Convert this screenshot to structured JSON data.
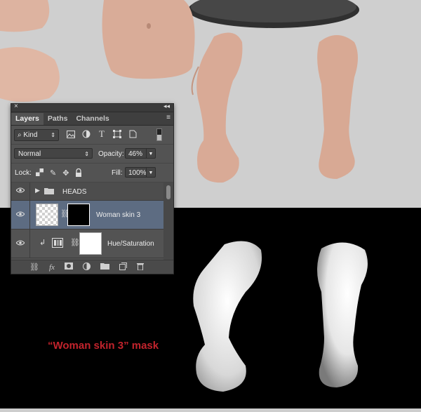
{
  "panel": {
    "close_glyph": "×",
    "collapse_glyph": "◂◂",
    "menu_glyph": "≡",
    "tabs": [
      {
        "label": "Layers"
      },
      {
        "label": "Paths"
      },
      {
        "label": "Channels"
      }
    ],
    "filter": {
      "kind_label": "Kind",
      "icons": [
        "image-filter-icon",
        "adjustment-filter-icon",
        "type-filter-icon",
        "shape-filter-icon",
        "smart-object-filter-icon"
      ]
    },
    "blend_mode": "Normal",
    "opacity_label": "Opacity:",
    "opacity_value": "46%",
    "lock_label": "Lock:",
    "fill_label": "Fill:",
    "fill_value": "100%",
    "layers": [
      {
        "name": "HEADS",
        "type": "group"
      },
      {
        "name": "Woman skin 3",
        "type": "layer-with-mask",
        "selected": true
      },
      {
        "name": "Hue/Saturation",
        "type": "adjustment"
      }
    ],
    "bottom_icons": [
      "link-icon",
      "fx-icon",
      "mask-icon",
      "adjustment-icon",
      "folder-icon",
      "new-layer-icon",
      "trash-icon"
    ]
  },
  "caption": "“Woman skin 3” mask",
  "colors": {
    "caption": "#c2232c",
    "selected_row": "#5d6c82",
    "panel_bg": "#535353"
  }
}
